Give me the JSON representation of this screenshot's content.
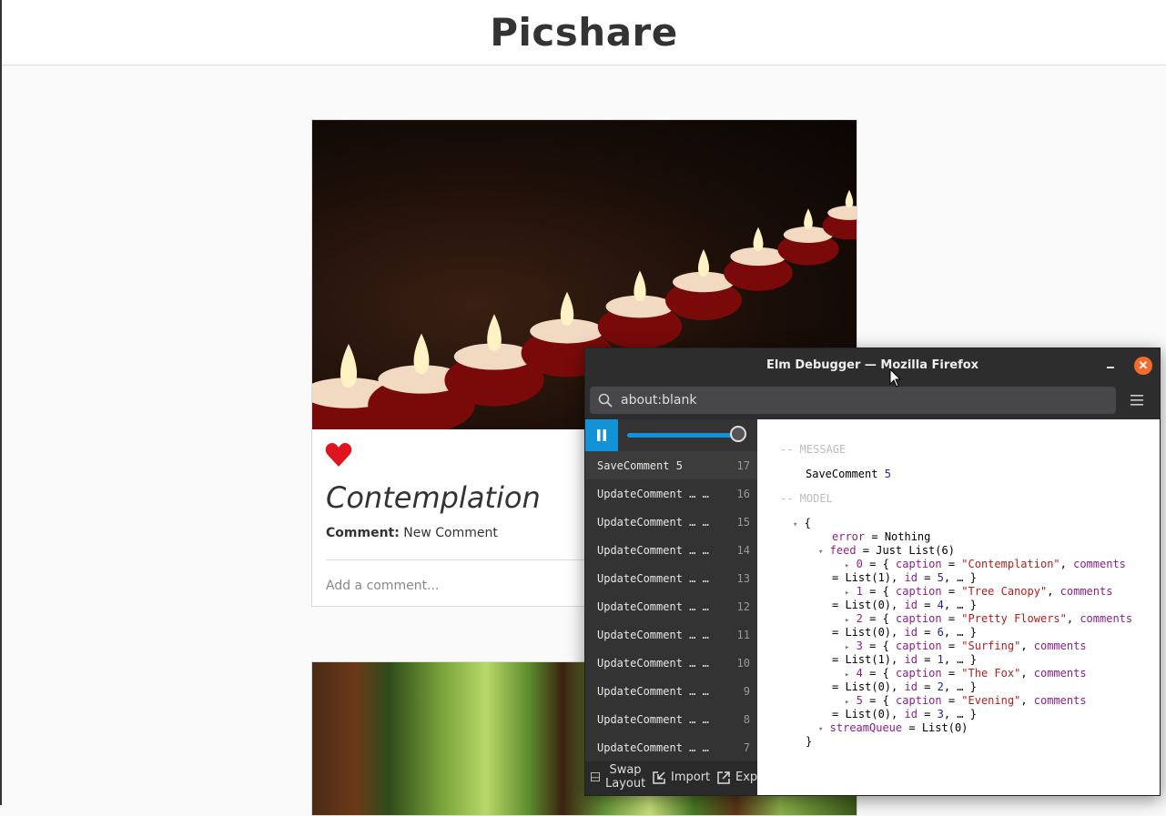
{
  "app": {
    "title": "Picshare"
  },
  "card1": {
    "caption": "Contemplation",
    "comment_label": "Comment:",
    "comment_text": "New Comment",
    "comment_placeholder": "Add a comment..."
  },
  "debugger": {
    "window_title": "Elm Debugger — Mozilla Firefox",
    "url": "about:blank",
    "messages": [
      {
        "name": "SaveComment 5",
        "index": "17"
      },
      {
        "name": "UpdateComment … …",
        "index": "16"
      },
      {
        "name": "UpdateComment … …",
        "index": "15"
      },
      {
        "name": "UpdateComment … …",
        "index": "14"
      },
      {
        "name": "UpdateComment … …",
        "index": "13"
      },
      {
        "name": "UpdateComment … …",
        "index": "12"
      },
      {
        "name": "UpdateComment … …",
        "index": "11"
      },
      {
        "name": "UpdateComment … …",
        "index": "10"
      },
      {
        "name": "UpdateComment … …",
        "index": "9"
      },
      {
        "name": "UpdateComment … …",
        "index": "8"
      },
      {
        "name": "UpdateComment … …",
        "index": "7"
      }
    ],
    "footer": {
      "swap_label": "Swap Layout",
      "import_label": "Import",
      "export_label": "Export"
    },
    "message_section_label": "-- MESSAGE",
    "message": {
      "name": "SaveComment",
      "arg": "5"
    },
    "model_section_label": "-- MODEL",
    "model": {
      "open_brace": "{",
      "close_brace": "}",
      "error_key": "error",
      "error_value": "Nothing",
      "feed_key": "feed",
      "feed_value": "Just List(6)",
      "feed_items": [
        {
          "index": "0",
          "caption": "\"Contemplation\"",
          "comments": "List(1)",
          "id": "5"
        },
        {
          "index": "1",
          "caption": "\"Tree Canopy\"",
          "comments": "List(0)",
          "id": "4"
        },
        {
          "index": "2",
          "caption": "\"Pretty Flowers\"",
          "comments": "List(0)",
          "id": "6"
        },
        {
          "index": "3",
          "caption": "\"Surfing\"",
          "comments": "List(1)",
          "id": "1"
        },
        {
          "index": "4",
          "caption": "\"The Fox\"",
          "comments": "List(0)",
          "id": "2"
        },
        {
          "index": "5",
          "caption": "\"Evening\"",
          "comments": "List(0)",
          "id": "3"
        }
      ],
      "stream_key": "streamQueue",
      "stream_value": "List(0)"
    },
    "colors": {
      "accent": "#1293d8",
      "close": "#f46c2b",
      "field": "#8b1e8b",
      "string": "#b41d1d",
      "number": "#1e1e9e"
    }
  }
}
